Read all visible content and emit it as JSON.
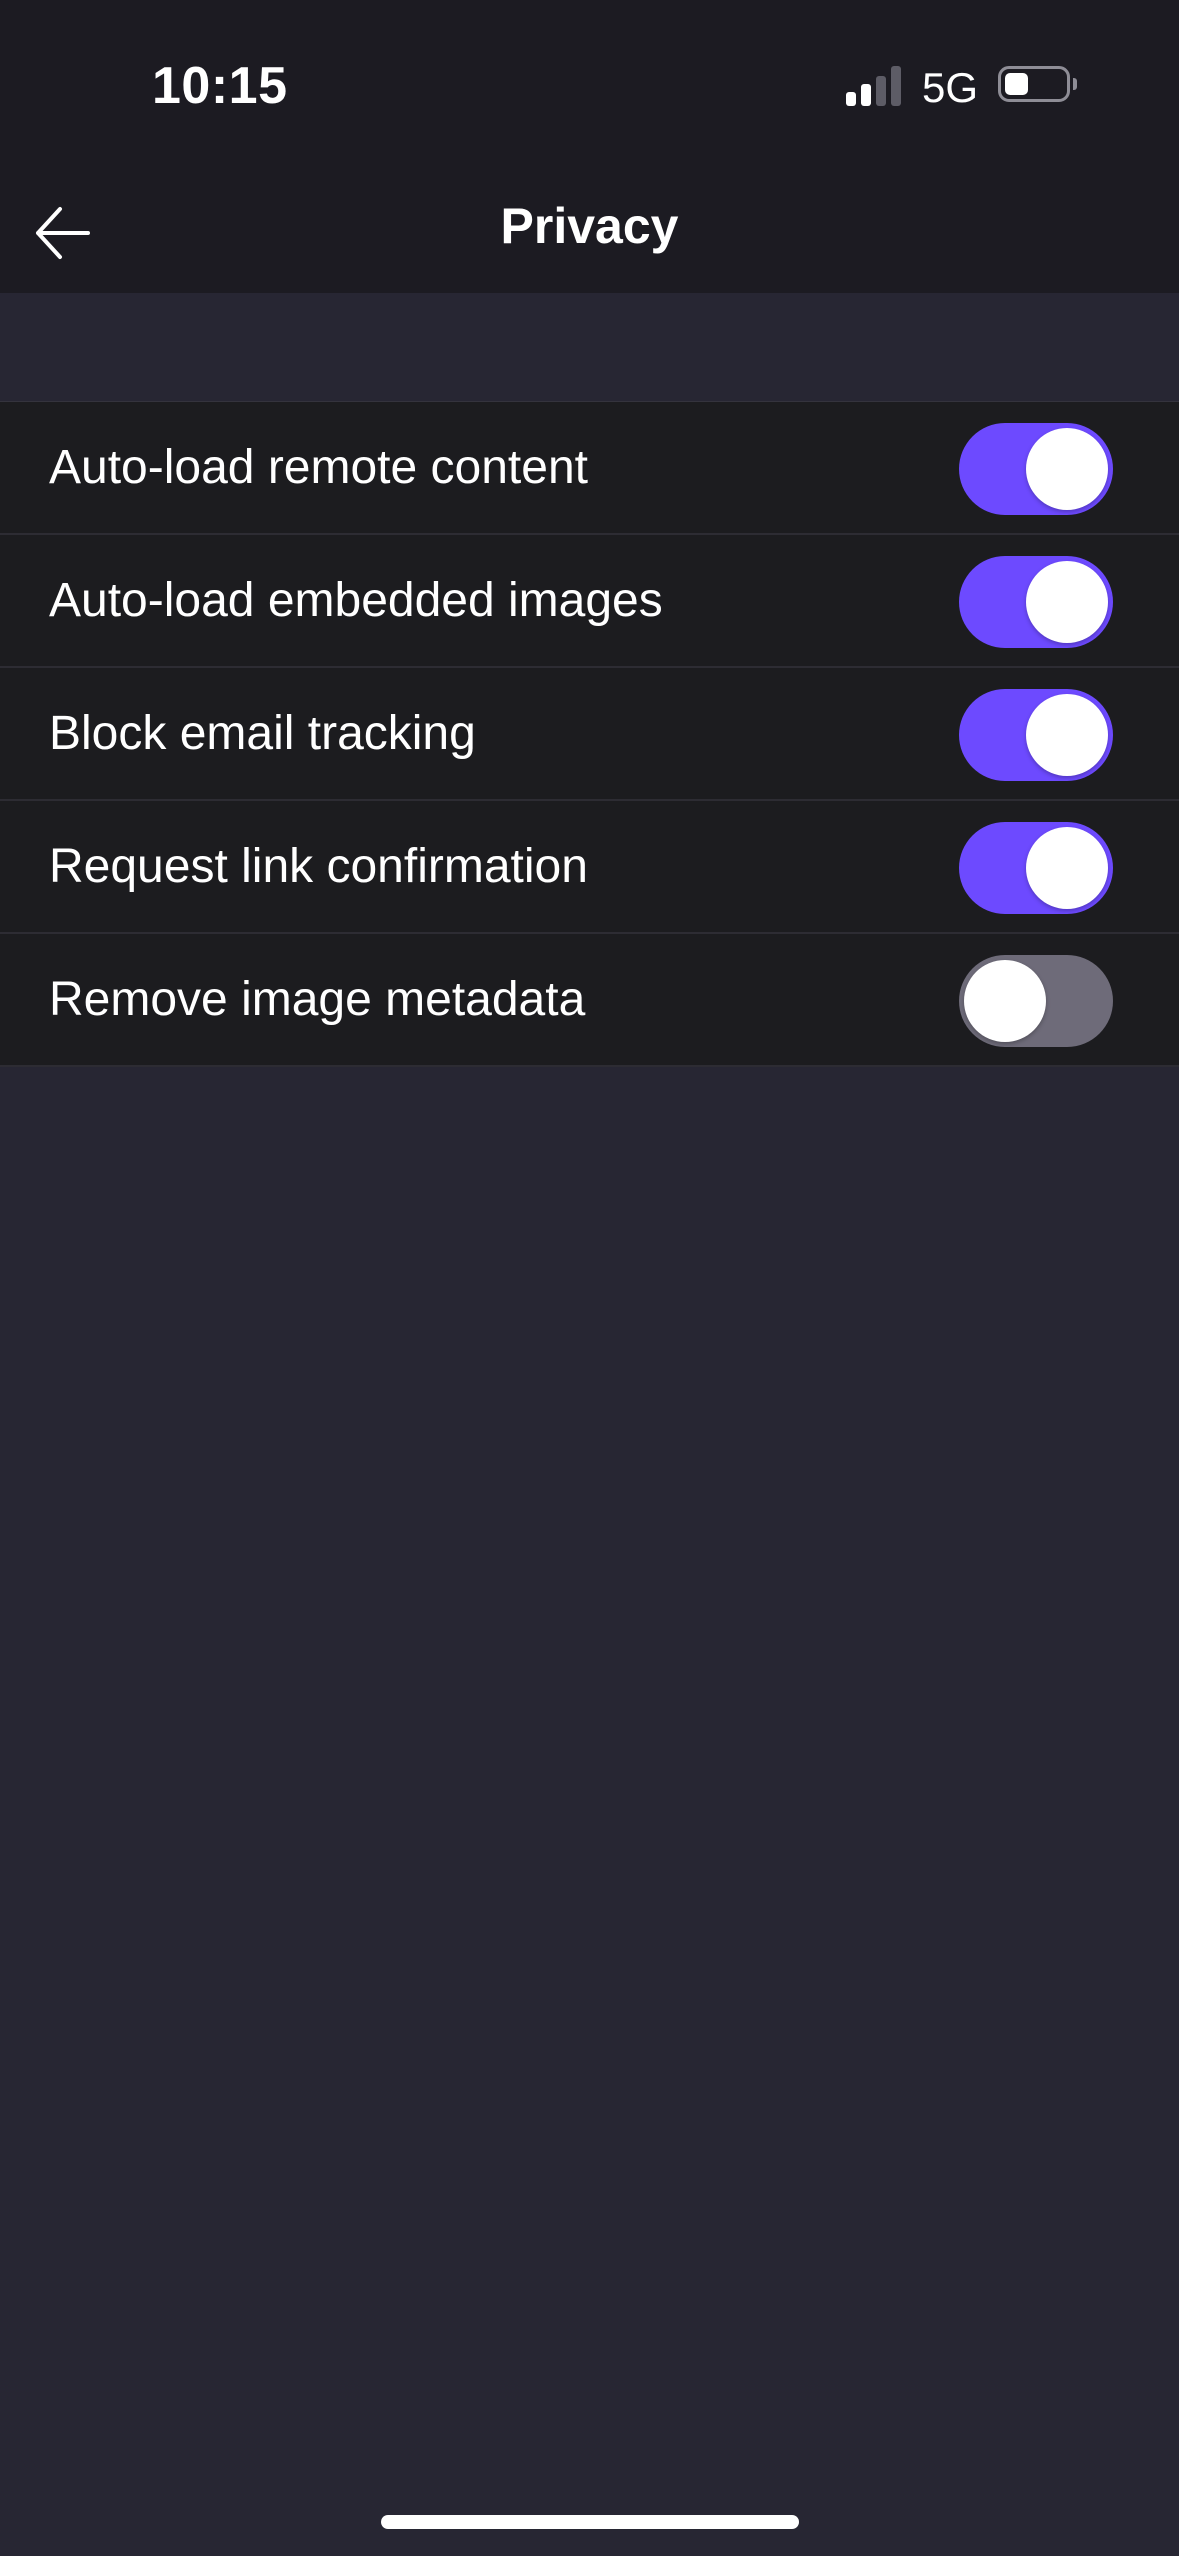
{
  "status_bar": {
    "time": "10:15",
    "network": "5G",
    "signal_bars_active": 2,
    "signal_bars_total": 4,
    "battery_level": 0.4
  },
  "nav": {
    "title": "Privacy",
    "back_icon": "arrow-left-icon"
  },
  "settings": [
    {
      "label": "Auto-load remote content",
      "enabled": true
    },
    {
      "label": "Auto-load embedded images",
      "enabled": true
    },
    {
      "label": "Block email tracking",
      "enabled": true
    },
    {
      "label": "Request link confirmation",
      "enabled": true
    },
    {
      "label": "Remove image metadata",
      "enabled": false
    }
  ],
  "colors": {
    "accent": "#6d4aff",
    "toggle_off": "#6e6b79",
    "background": "#272633",
    "row_background": "#1c1c1f"
  }
}
